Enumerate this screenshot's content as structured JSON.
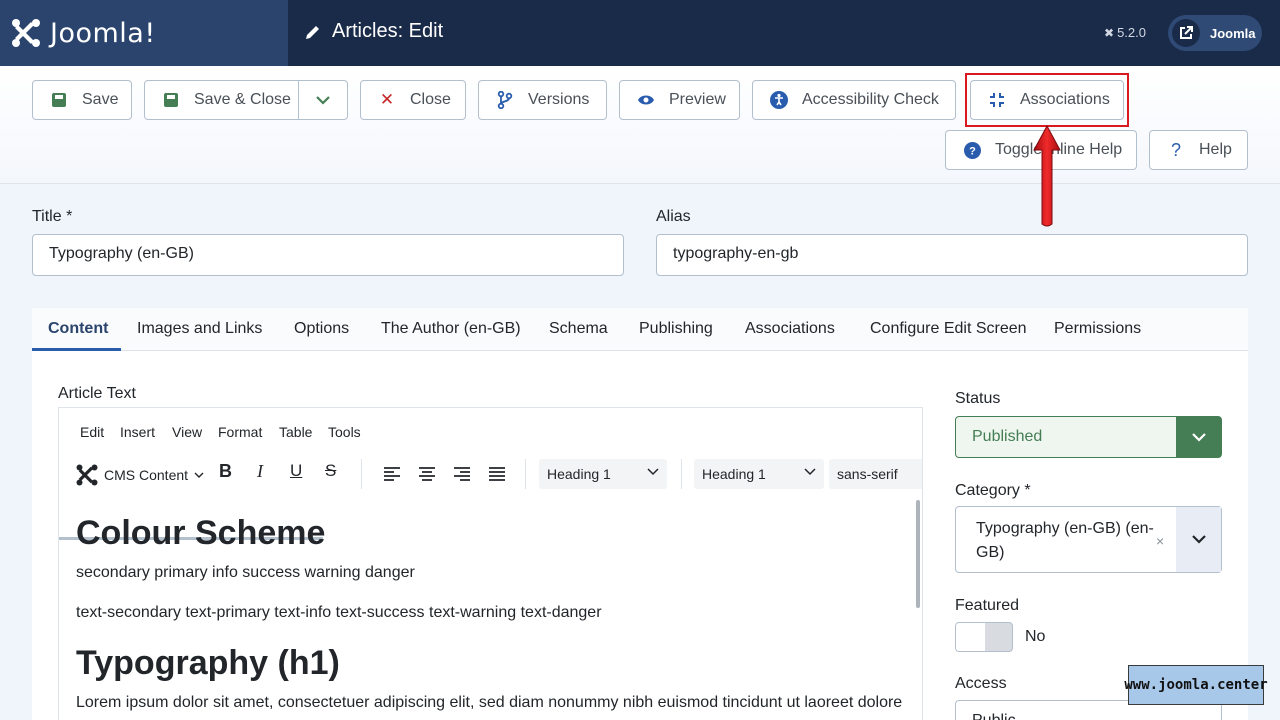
{
  "header": {
    "brand": "Joomla!",
    "title": "Articles: Edit",
    "version": "5.2.0",
    "user_label": "Joomla"
  },
  "toolbar": {
    "save": "Save",
    "save_close": "Save & Close",
    "close": "Close",
    "versions": "Versions",
    "preview": "Preview",
    "accessibility": "Accessibility Check",
    "associations": "Associations",
    "toggle_help": "Toggle Inline Help",
    "help": "Help"
  },
  "form": {
    "title_label": "Title *",
    "title_value": "Typography (en-GB)",
    "alias_label": "Alias",
    "alias_value": "typography-en-gb"
  },
  "tabs": [
    "Content",
    "Images and Links",
    "Options",
    "The Author (en-GB)",
    "Schema",
    "Publishing",
    "Associations",
    "Configure Edit Screen",
    "Permissions"
  ],
  "editor": {
    "label": "Article Text",
    "menu": [
      "Edit",
      "Insert",
      "View",
      "Format",
      "Table",
      "Tools"
    ],
    "cms_content": "CMS Content",
    "block_format": "Heading 1",
    "style_format": "Heading 1",
    "font": "sans-serif",
    "content": {
      "h1_a": "Colour Scheme",
      "p1": "secondary primary info success warning danger",
      "p2": "text-secondary text-primary text-info text-success text-warning text-danger",
      "h1_b": "Typography (h1)",
      "p3": "Lorem ipsum dolor sit amet, consectetuer adipiscing elit, sed diam nonummy nibh euismod tincidunt ut laoreet dolore"
    }
  },
  "sidebar": {
    "status_label": "Status",
    "status_value": "Published",
    "category_label": "Category *",
    "category_value": "Typography (en-GB) (en-GB)",
    "featured_label": "Featured",
    "featured_value": "No",
    "access_label": "Access",
    "access_value": "Public"
  },
  "watermark": "www.joomla.center",
  "colors": {
    "header_bg": "#1a2b49",
    "brand_bg": "#2a446d",
    "success": "#457d54",
    "highlight": "#d9191f"
  }
}
